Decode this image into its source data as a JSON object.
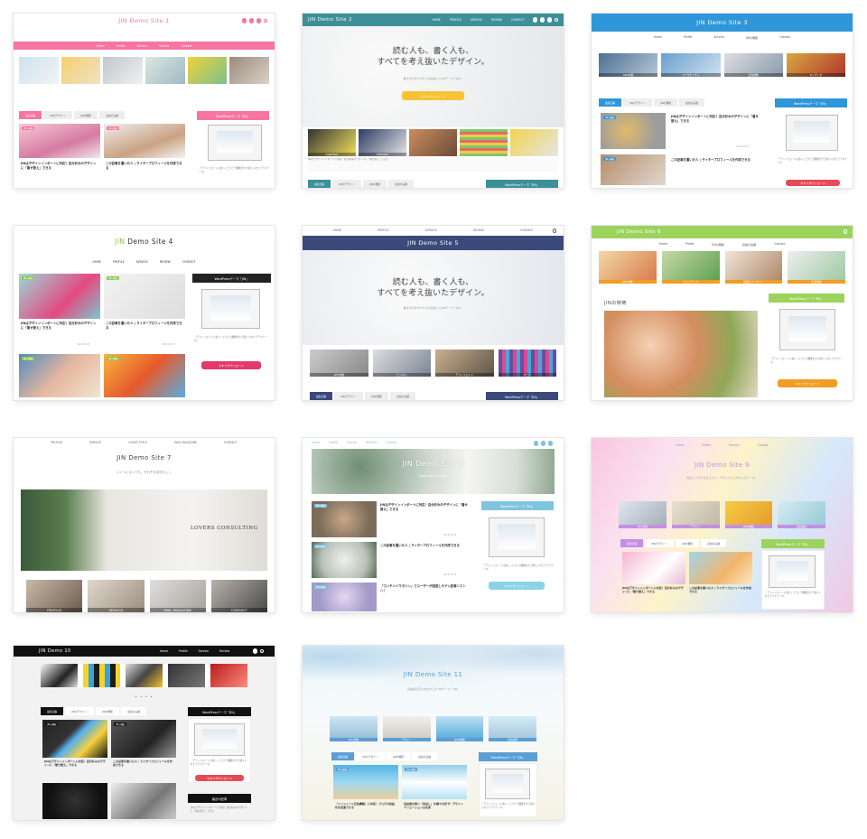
{
  "common": {
    "nav_en": [
      "Home",
      "Profile",
      "Service",
      "Contact"
    ],
    "nav_caps": [
      "HOME",
      "PROFILE",
      "SERVICE",
      "REVIEW",
      "CONTACT"
    ],
    "tabs_ja": [
      "最新記事",
      "JINのデザイン",
      "JINの機能",
      "収益の実績"
    ],
    "widget_title": "WordPressテーマ「JIN」",
    "widget_desc": "「アフィリエイトに強い」とうたう機能を全て取り入れたモデルテーマ。",
    "dl_button": "今すぐダウンロード",
    "hero_line1": "読む人も、書く人も、",
    "hero_line2": "すべてを考え抜いたデザイン。",
    "hero_sub": "書き手の作りやすさを追求したWPテーマ「JIN」",
    "post1": "JINはデザインインポートに対応！自分好みのデザインに「着せ替え」できる",
    "post2": "この記事を書いた人 | ライタープロフィールを作成できる",
    "date": "2018.03.15",
    "badge": "JINの機能",
    "cats": [
      "SEO対策",
      "デザイン",
      "JINの機能",
      "収益事例"
    ]
  },
  "sites": {
    "s1": {
      "title": "JIN Demo Site 1"
    },
    "s2": {
      "title": "JIN Demo Site 2",
      "cats": [
        "CONTENT",
        "ERTISING"
      ]
    },
    "s3": {
      "title": "JIN Demo Site 3",
      "cats": [
        "SEO対策",
        "ユーザビリティ",
        "広告戦略",
        "マッチング"
      ]
    },
    "s4": {
      "title_accent": "JIN",
      "title_rest": " Demo Site 4"
    },
    "s5": {
      "title": "JIN Demo Site 5",
      "cats": [
        "SEO対策",
        "ビジネス",
        "アフィリエイト",
        "マーケ"
      ]
    },
    "s6": {
      "title": "JIN Demo Site 6",
      "section": "JINの特徴",
      "cats": [
        "SEO対策",
        "ビジュアップ",
        "商品をプッチャー",
        "広告戦略"
      ]
    },
    "s7": {
      "title": "JIN Demo Site 7",
      "tagline": "いくつになっても、それぞれ自分らしく",
      "hero_text": "LOVERS CONSULTING",
      "tiles": [
        "PROFILE",
        "SERVICE",
        "MAIL MAGAZINE",
        "CONTACT"
      ],
      "nav": [
        "PROFILE",
        "SERVICE",
        "LOVER STYLE",
        "MAIL MAGAZINE",
        "CONTACT"
      ]
    },
    "s8": {
      "title": "JIN Demo Site 8",
      "subtitle": "Digital Design & Life",
      "post3": "「コンテンツマガジン」でユーザーが回遊しやすい記事リストへ！"
    },
    "s9": {
      "title": "JIN Demo Site 9",
      "sub": "知ることができるように、デザインにこだわったテーマ。"
    },
    "s10": {
      "title": "JIN Demo 10",
      "nav": [
        "Home",
        "Profile",
        "Service",
        "Review"
      ],
      "popular": "最近の記事"
    },
    "s11": {
      "title": "JIN Demo Site 11",
      "sub": "自由度の高さを生かした WPテーマ「JIN」",
      "post1": "「インフィード広告機能」に対応！ブログの収益化を加速できる",
      "post2": "自由度の高い「見出し」を様々な形で！デザインバリエーションは充実"
    }
  },
  "colors": {
    "pink": "#f7759f",
    "teal": "#3d8f98",
    "blue": "#2f96d9",
    "navy": "#3b4a7a",
    "green": "#9bd35c",
    "ltblue": "#7fc3df",
    "purple": "#c58fe3",
    "orange": "#f39c22",
    "yellow": "#f7c333",
    "red": "#e64a56"
  }
}
